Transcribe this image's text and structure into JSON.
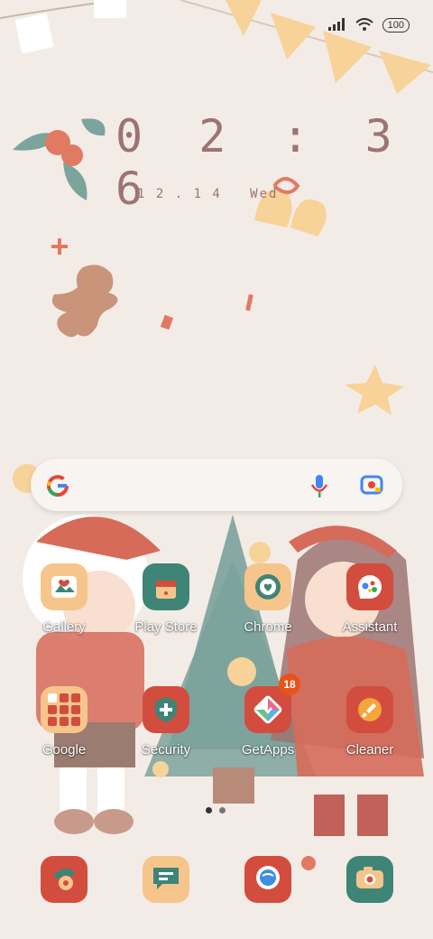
{
  "status": {
    "battery": "100"
  },
  "clock": {
    "time": "0 2 : 3 6",
    "date": "1 2 . 1 4   Wed"
  },
  "apps": [
    {
      "label": "Gallery",
      "bg": "#f6c58c"
    },
    {
      "label": "Play Store",
      "bg": "#3e8577"
    },
    {
      "label": "Chrome",
      "bg": "#f6c58c"
    },
    {
      "label": "Assistant",
      "bg": "#d24d3e"
    },
    {
      "label": "Google",
      "bg": "#f6c58c"
    },
    {
      "label": "Security",
      "bg": "#d24d3e"
    },
    {
      "label": "GetApps",
      "bg": "#d24d3e",
      "badge": "18"
    },
    {
      "label": "Cleaner",
      "bg": "#d24d3e"
    }
  ],
  "dock": [
    {
      "icon": "phone-icon",
      "bg": "#d24d3e"
    },
    {
      "icon": "messages-icon",
      "bg": "#f6c58c"
    },
    {
      "icon": "browser-icon",
      "bg": "#d24d3e"
    },
    {
      "icon": "camera-icon",
      "bg": "#3e8577"
    }
  ]
}
